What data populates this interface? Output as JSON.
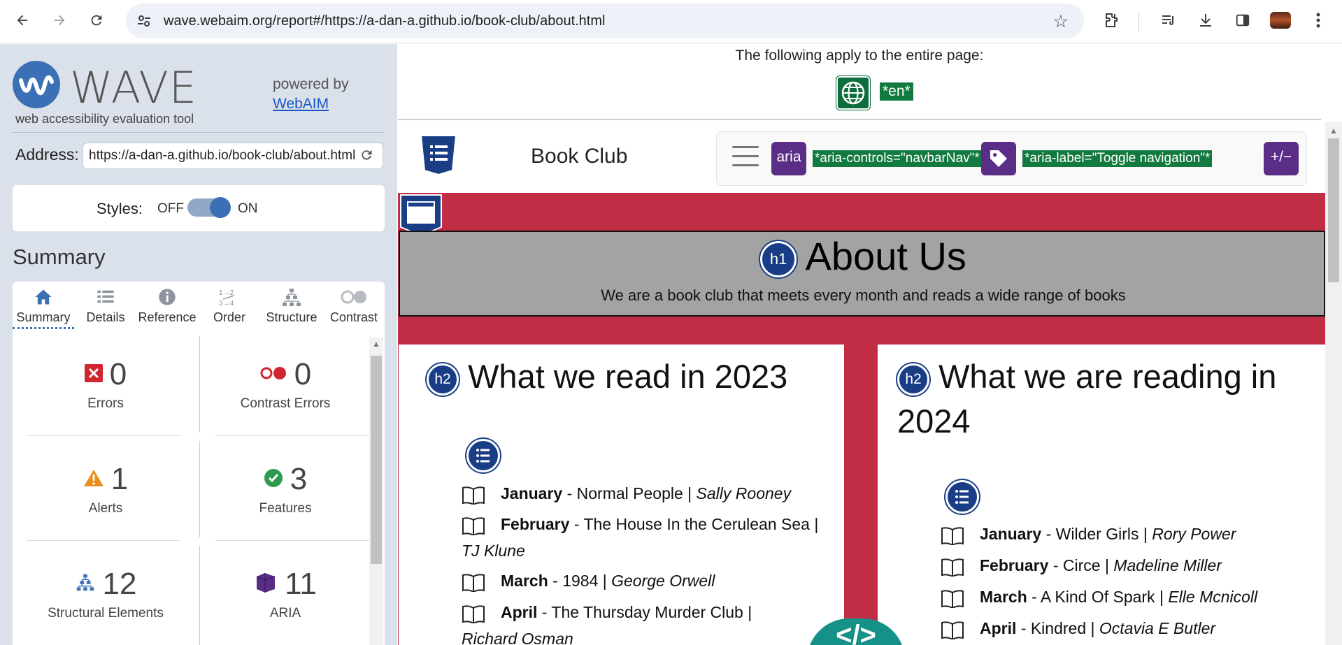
{
  "browser": {
    "url": "wave.webaim.org/report#/https://a-dan-a.github.io/book-club/about.html"
  },
  "wave": {
    "logo": "WAVE",
    "tagline": "web accessibility evaluation tool",
    "powered_by": "powered by",
    "webaim_link": "WebAIM",
    "address_label": "Address:",
    "address_value": "https://a-dan-a.github.io/book-club/about.html",
    "styles_label": "Styles:",
    "styles_off": "OFF",
    "styles_on": "ON",
    "styles_state": "on",
    "summary_title": "Summary",
    "tabs": [
      {
        "label": "Summary",
        "icon": "home-icon"
      },
      {
        "label": "Details",
        "icon": "list-icon"
      },
      {
        "label": "Reference",
        "icon": "info-icon"
      },
      {
        "label": "Order",
        "icon": "order-icon"
      },
      {
        "label": "Structure",
        "icon": "structure-icon"
      },
      {
        "label": "Contrast",
        "icon": "contrast-icon"
      }
    ],
    "stats": {
      "errors": {
        "count": "0",
        "label": "Errors"
      },
      "contrast_errors": {
        "count": "0",
        "label": "Contrast Errors"
      },
      "alerts": {
        "count": "1",
        "label": "Alerts"
      },
      "features": {
        "count": "3",
        "label": "Features"
      },
      "structural": {
        "count": "12",
        "label": "Structural Elements"
      },
      "aria": {
        "count": "11",
        "label": "ARIA"
      }
    }
  },
  "page": {
    "applies_text": "The following apply to the entire page:",
    "lang_tag": "*en*",
    "brand": "Book Club",
    "aria_icon_label": "aria",
    "aria_controls": "*aria-controls=\"navbarNav\"*",
    "aria_label": "*aria-label=\"Toggle navigation\"*",
    "aria_expanded_icon": "+/−",
    "h1_badge": "h1",
    "h1": "About Us",
    "subtitle": "We are a book club that meets every month and reads a wide range of books",
    "h2_badge": "h2",
    "left_heading": "What we read in 2023",
    "right_heading": "What we are reading in 2024",
    "left_books": [
      {
        "month": "January",
        "title": " - Normal People | ",
        "author": "Sally Rooney"
      },
      {
        "month": "February",
        "title": " - The House In the Cerulean Sea | ",
        "author": "TJ Klune"
      },
      {
        "month": "March",
        "title": " - 1984 | ",
        "author": "George Orwell"
      },
      {
        "month": "April",
        "title": " - The Thursday Murder Club | ",
        "author": "Richard Osman"
      }
    ],
    "right_books": [
      {
        "month": "January",
        "title": " - Wilder Girls | ",
        "author": "Rory Power"
      },
      {
        "month": "February",
        "title": " - Circe | ",
        "author": "Madeline Miller"
      },
      {
        "month": "March",
        "title": " - A Kind Of Spark | ",
        "author": "Elle Mcnicoll"
      },
      {
        "month": "April",
        "title": " - Kindred | ",
        "author": "Octavia E Butler"
      }
    ],
    "code_icon": "</>"
  },
  "colors": {
    "wave_blue": "#3b6fb6",
    "aria_purple": "#5a2d87",
    "tag_green": "#137a3f",
    "band_red": "#c22d46",
    "heading_badge": "#1a3e86",
    "code_teal": "#149287"
  }
}
